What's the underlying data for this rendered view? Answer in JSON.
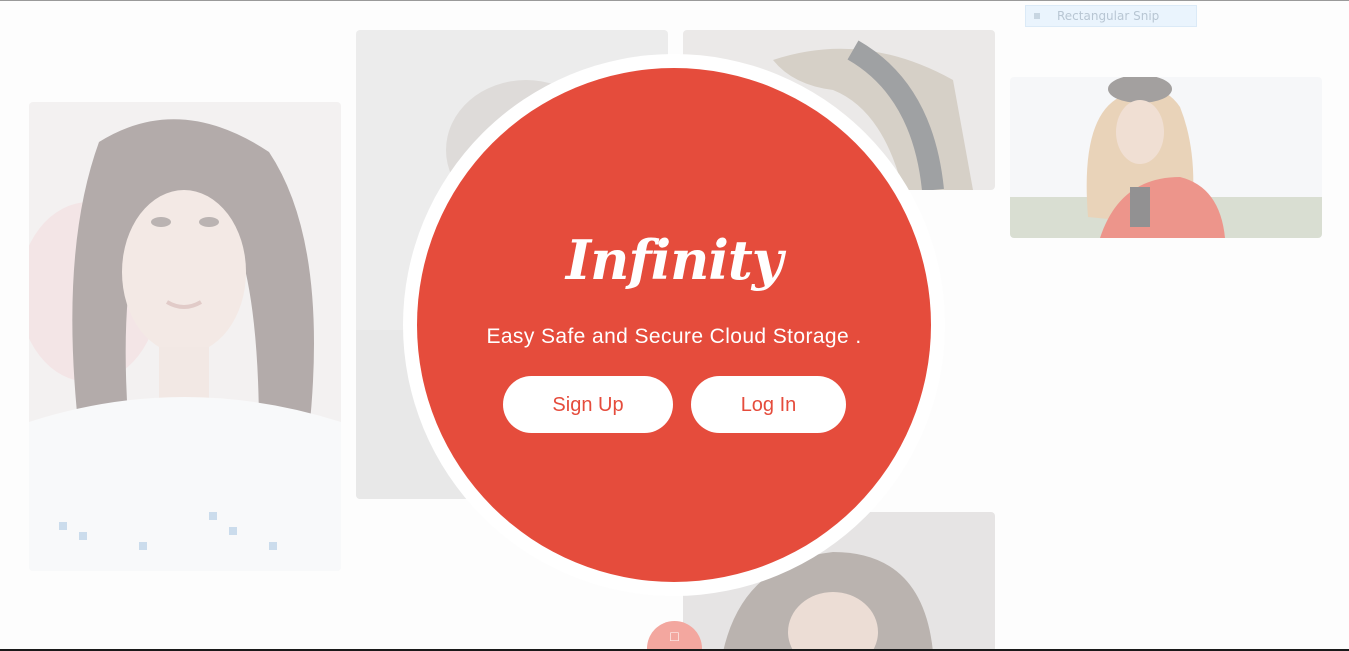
{
  "hero": {
    "brand": "Infinity",
    "tagline": "Easy Safe and Secure Cloud Storage .",
    "signup_label": "Sign Up",
    "login_label": "Log In"
  },
  "overlay": {
    "snip_label": "Rectangular Snip"
  },
  "fab": {
    "icon": "chevron-up-icon",
    "glyph": "□"
  },
  "colors": {
    "accent": "#e54c3c",
    "ring": "#ffffff",
    "background": "#fdfdfd"
  }
}
